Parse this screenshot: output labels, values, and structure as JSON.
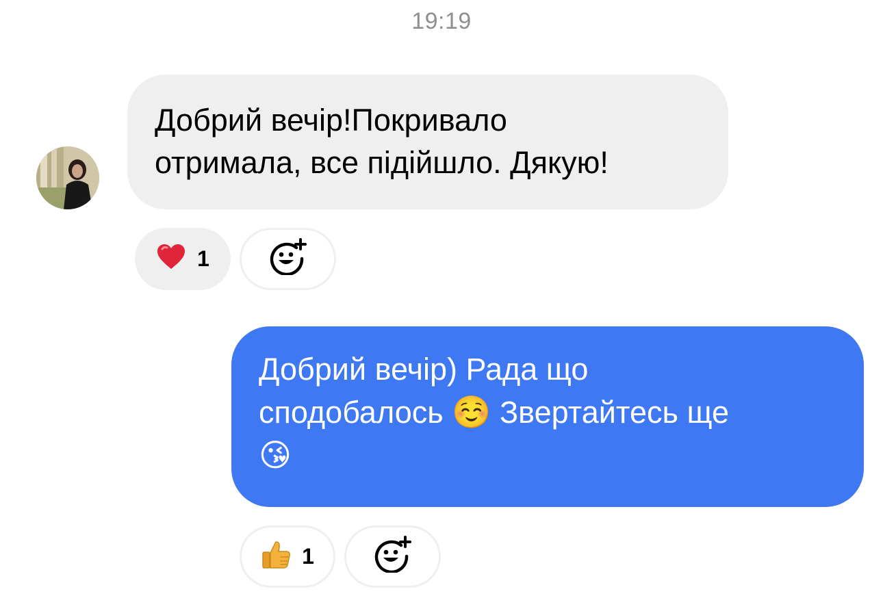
{
  "conversation": {
    "timestamp": "19:19",
    "messages": [
      {
        "direction": "incoming",
        "lines": [
          "Добрий вечір!Покривало",
          "отримала, все підійшло. Дякую!"
        ],
        "reaction": {
          "icon": "heart-icon",
          "emoji": "❤️",
          "count": "1"
        }
      },
      {
        "direction": "outgoing",
        "line1": "Добрий вечір) Рада що",
        "line2_text_a": "сподобалось ",
        "line2_emoji": "☺️",
        "line2_text_b": " Звертайтесь ще",
        "line3_emoji": "😘",
        "reaction": {
          "icon": "thumbs-up-icon",
          "emoji": "👍",
          "count": "1"
        }
      }
    ]
  },
  "colors": {
    "incoming_bubble": "#efefef",
    "outgoing_bubble": "#3e78f2",
    "timestamp_text": "#8e8e93",
    "heart": "#e0243a",
    "thumb": "#f4b23c"
  }
}
